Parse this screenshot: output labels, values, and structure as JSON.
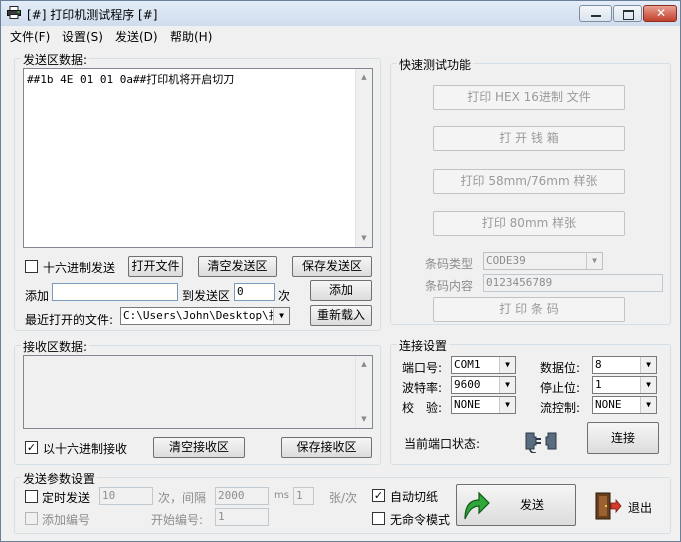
{
  "window": {
    "title": "[#] 打印机测试程序 [#]"
  },
  "menu": [
    "文件(F)",
    "设置(S)",
    "发送(D)",
    "帮助(H)"
  ],
  "send_area": {
    "label": "发送区数据:",
    "content": "##1b 4E 01 01 0a##打印机将开启切刀",
    "hex_send_label": "十六进制发送",
    "hex_send_checked": false,
    "open_file": "打开文件",
    "clear_send": "清空发送区",
    "save_send": "保存发送区",
    "add_label": "添加",
    "add_value": "",
    "to_send_area_label": "到发送区",
    "times_value": "0",
    "times_unit": "次",
    "add_button": "添加",
    "recent_label": "最近打开的文件:",
    "recent_value": "C:\\Users\\John\\Desktop\\打印",
    "reload_button": "重新载入"
  },
  "receive_area": {
    "label": "接收区数据:",
    "content": "",
    "hex_receive_label": "以十六进制接收",
    "hex_receive_checked": true,
    "clear_receive": "清空接收区",
    "save_receive": "保存接收区"
  },
  "quick_test": {
    "label": "快速测试功能",
    "print_hex": "打印 HEX 16进制 文件",
    "open_drawer": "打 开 钱 箱",
    "print_58_76": "打印 58mm/76mm 样张",
    "print_80": "打印 80mm 样张",
    "barcode_type_label": "条码类型",
    "barcode_type_value": "CODE39",
    "barcode_content_label": "条码内容",
    "barcode_content_value": "0123456789",
    "print_barcode": "打 印 条 码"
  },
  "connection": {
    "label": "连接设置",
    "port_label": "端口号:",
    "port_value": "COM1",
    "databits_label": "数据位:",
    "databits_value": "8",
    "baud_label": "波特率:",
    "baud_value": "9600",
    "stopbits_label": "停止位:",
    "stopbits_value": "1",
    "parity_label": "校　验:",
    "parity_value": "NONE",
    "flow_label": "流控制:",
    "flow_value": "NONE",
    "status_label": "当前端口状态:",
    "connect_button": "连接"
  },
  "send_params": {
    "label": "发送参数设置",
    "timed_send_label": "定时发送",
    "timed_send_checked": false,
    "count_value": "10",
    "interval_label": "次，间隔",
    "interval_value": "2000",
    "ms_label": "ms",
    "sheets_value": "1",
    "per_time_label": "张/次",
    "auto_cut_label": "自动切纸",
    "auto_cut_checked": true,
    "add_number_label": "添加编号",
    "add_number_checked": false,
    "start_number_label": "开始编号:",
    "start_number_value": "1",
    "no_cmd_label": "无命令模式",
    "no_cmd_checked": false,
    "send_button": "发送",
    "exit_button": "退出"
  }
}
